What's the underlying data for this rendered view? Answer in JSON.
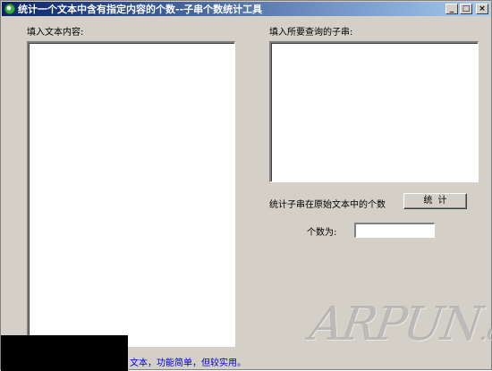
{
  "window": {
    "title": "统计一个文本中含有指定内容的个数--子串个数统计工具",
    "minimize_glyph": "_",
    "maximize_glyph": "□",
    "close_glyph": "×"
  },
  "left_panel": {
    "label": "填入文本内容:",
    "text_value": ""
  },
  "right_panel": {
    "label": "填入所要查询的子串:",
    "text_value": ""
  },
  "count_row": {
    "label": "统计子串在原始文本中的个数",
    "button_label": "统计"
  },
  "result_row": {
    "label": "个数为:",
    "value": ""
  },
  "footer": {
    "text": "文本，功能简单，但较实用。"
  },
  "watermark": {
    "text_main": "ARPUN",
    "text_suffix": ".com"
  },
  "colors": {
    "window_bg": "#d4d0c8",
    "title_start": "#0a246a",
    "title_end": "#a6caf0",
    "footer_text": "#0000cc"
  }
}
